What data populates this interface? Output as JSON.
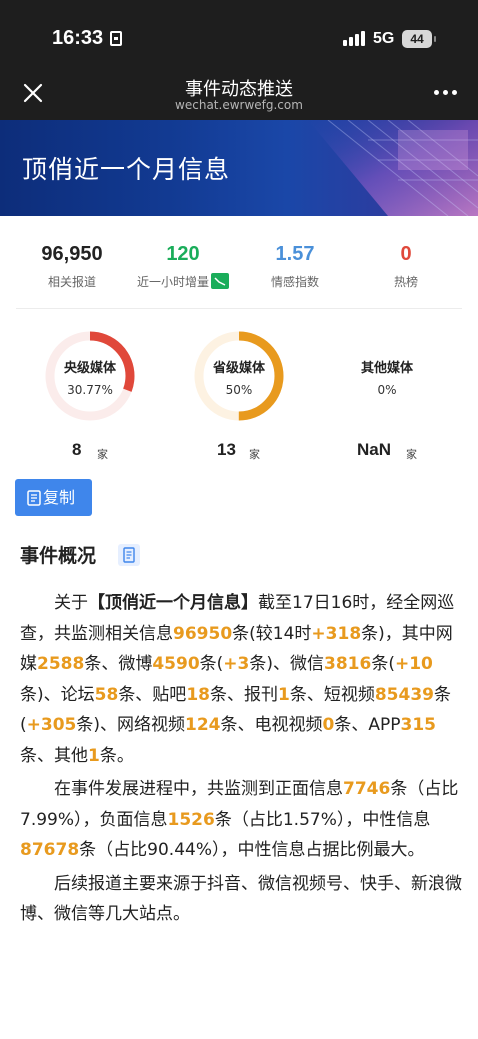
{
  "status_bar": {
    "time": "16:33",
    "network": "5G",
    "battery": "44"
  },
  "nav": {
    "title": "事件动态推送",
    "subtitle": "wechat.ewrwefg.com"
  },
  "banner": {
    "title": "顶俏近一个月信息"
  },
  "stats": [
    {
      "value": "96,950",
      "label": "相关报道",
      "color": "#222222"
    },
    {
      "value": "120",
      "label": "近一小时增量",
      "color": "#1aad5a"
    },
    {
      "value": "1.57",
      "label": "情感指数",
      "color": "#4a90d9"
    },
    {
      "value": "0",
      "label": "热榜",
      "color": "#e0483a"
    }
  ],
  "media": [
    {
      "name": "央级媒体",
      "percent_label": "30.77%",
      "percent": 30.77,
      "count": "8",
      "unit": "家",
      "color": "#e0483a",
      "track": "#fbeceb"
    },
    {
      "name": "省级媒体",
      "percent_label": "50%",
      "percent": 50,
      "count": "13",
      "unit": "家",
      "color": "#e89a1e",
      "track": "#fdf2e2"
    },
    {
      "name": "其他媒体",
      "percent_label": "0%",
      "percent": 0,
      "count": "NaN",
      "unit": "家",
      "color": "#cccccc",
      "track": "#ffffff"
    }
  ],
  "copy_button": {
    "label": "复制"
  },
  "section": {
    "title": "事件概况"
  },
  "article": {
    "p1": [
      {
        "t": "关于"
      },
      {
        "t": "【顶俏近一个月信息】",
        "s": "bold"
      },
      {
        "t": "截至17日16时，经全网巡查，共监测相关信息"
      },
      {
        "t": "96950",
        "s": "hl"
      },
      {
        "t": "条(较14时"
      },
      {
        "t": "+318",
        "s": "hl"
      },
      {
        "t": "条)，其中网媒"
      },
      {
        "t": "2588",
        "s": "hl"
      },
      {
        "t": "条、微博"
      },
      {
        "t": "4590",
        "s": "hl"
      },
      {
        "t": "条("
      },
      {
        "t": "+3",
        "s": "hl"
      },
      {
        "t": "条)、微信"
      },
      {
        "t": "3816",
        "s": "hl"
      },
      {
        "t": "条("
      },
      {
        "t": "+10",
        "s": "hl"
      },
      {
        "t": "条)、论坛"
      },
      {
        "t": "58",
        "s": "hl"
      },
      {
        "t": "条、贴吧"
      },
      {
        "t": "18",
        "s": "hl"
      },
      {
        "t": "条、报刊"
      },
      {
        "t": "1",
        "s": "hl"
      },
      {
        "t": "条、短视频"
      },
      {
        "t": "85439",
        "s": "hl"
      },
      {
        "t": "条("
      },
      {
        "t": "+305",
        "s": "hl"
      },
      {
        "t": "条)、网络视频"
      },
      {
        "t": "124",
        "s": "hl"
      },
      {
        "t": "条、电视视频"
      },
      {
        "t": "0",
        "s": "hl"
      },
      {
        "t": "条、APP"
      },
      {
        "t": "315",
        "s": "hl"
      },
      {
        "t": "条、其他"
      },
      {
        "t": "1",
        "s": "hl"
      },
      {
        "t": "条。"
      }
    ],
    "p2": [
      {
        "t": "在事件发展进程中，共监测到正面信息"
      },
      {
        "t": "7746",
        "s": "hl"
      },
      {
        "t": "条（占比7.99%），负面信息"
      },
      {
        "t": "1526",
        "s": "hl"
      },
      {
        "t": "条（占比1.57%），中性信息"
      },
      {
        "t": "87678",
        "s": "hl"
      },
      {
        "t": "条（占比90.44%），中性信息占据比例最大。"
      }
    ],
    "p3": [
      {
        "t": "后续报道主要来源于抖音、微信视频号、快手、新浪微博、微信等几大站点。"
      }
    ]
  }
}
